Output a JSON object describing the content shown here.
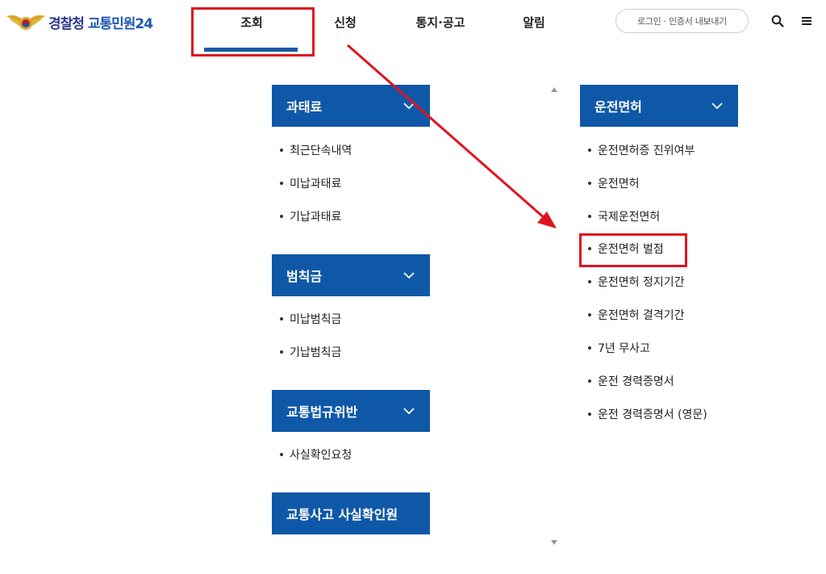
{
  "header": {
    "logo": {
      "part1": "경찰청",
      "part2": "교통민원24"
    },
    "nav": [
      {
        "label": "조회",
        "active": true
      },
      {
        "label": "신청"
      },
      {
        "label": "통지·공고"
      },
      {
        "label": "알림"
      }
    ],
    "login_button": "로그인 · 인증서 내보내기",
    "icons": [
      "search-icon",
      "menu-icon"
    ]
  },
  "menu": {
    "left": [
      {
        "title": "과태료",
        "items": [
          "최근단속내역",
          "미납과태료",
          "기납과태료"
        ]
      },
      {
        "title": "범칙금",
        "items": [
          "미납범칙금",
          "기납범칙금"
        ]
      },
      {
        "title": "교통법규위반",
        "items": [
          "사실확인요청"
        ]
      },
      {
        "title": "교통사고 사실확인원",
        "items": []
      }
    ],
    "right": [
      {
        "title": "운전면허",
        "items": [
          "운전면허증 진위여부",
          "운전면허",
          "국제운전면허",
          "운전면허 벌점",
          "운전면허 정지기간",
          "운전면허 결격기간",
          "7년 무사고",
          "운전 경력증명서",
          "운전 경력증명서 (영문)"
        ]
      }
    ]
  },
  "colors": {
    "primary": "#0f58a8",
    "active_bar": "#1c57a8",
    "annotation": "#e0141e"
  }
}
